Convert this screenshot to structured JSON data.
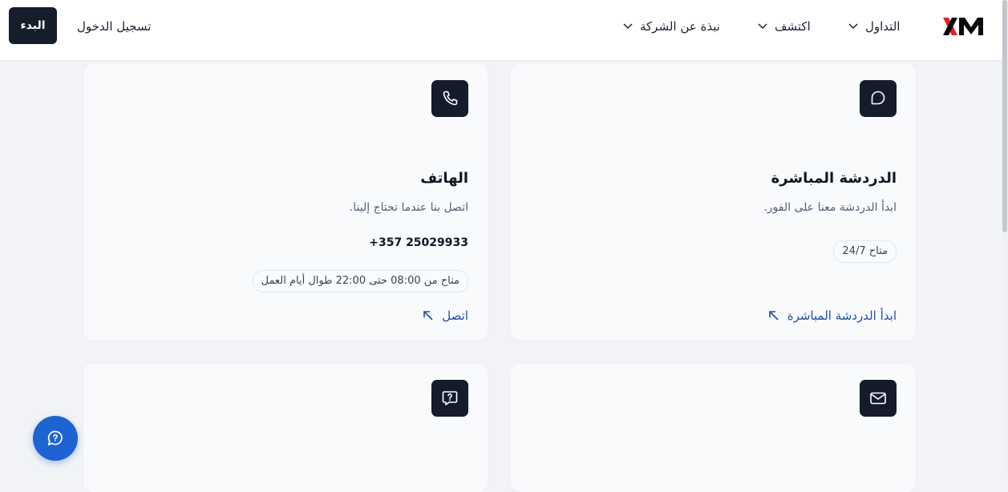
{
  "header": {
    "nav": [
      {
        "label": "التداول"
      },
      {
        "label": "اكتشف"
      },
      {
        "label": "نبذة عن الشركة"
      }
    ],
    "login_label": "تسجيل الدخول",
    "start_label": "البدء"
  },
  "cards": {
    "chat": {
      "title": "الدردشة المباشرة",
      "description": "ابدأ الدردشة معنا على الفور.",
      "badge": "متاح 24/7",
      "link": "ابدأ الدردشة المباشرة"
    },
    "phone": {
      "title": "الهاتف",
      "description": "اتصل بنا عندما تحتاج إلينا.",
      "number": "+357 25029933",
      "badge": "متاح من 08:00 حتى 22:00 طوال أيام العمل",
      "link": "اتصل"
    }
  },
  "colors": {
    "accent": "#1e63d2",
    "dark": "#141c2b",
    "logo_red": "#e3232b",
    "link": "#1f4e9e"
  }
}
